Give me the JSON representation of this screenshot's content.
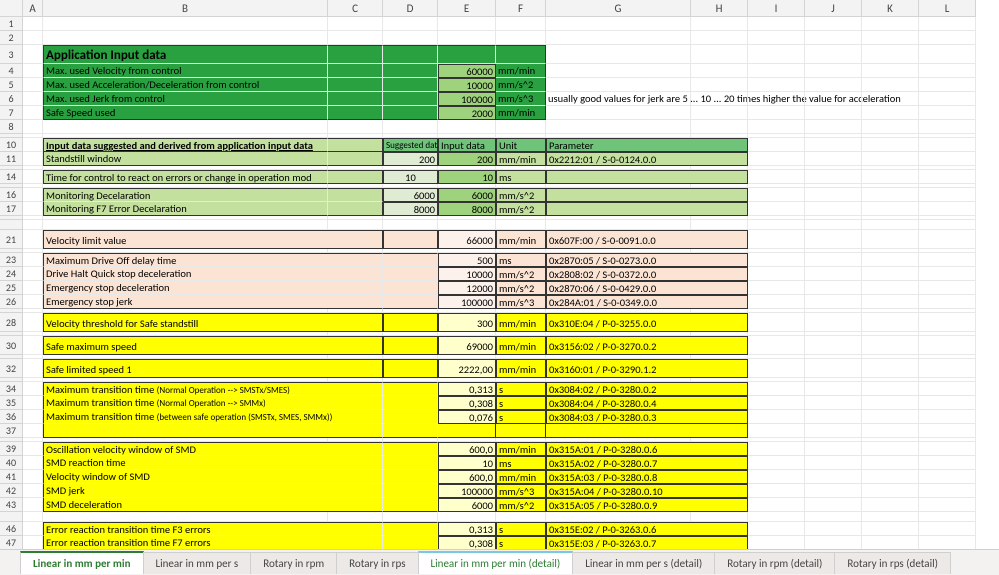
{
  "columns": [
    "A",
    "B",
    "C",
    "D",
    "E",
    "F",
    "G",
    "H",
    "I",
    "J",
    "K",
    "L"
  ],
  "rowNums": [
    "1",
    "2",
    "3",
    "4",
    "5",
    "6",
    "7",
    "8",
    "",
    "10",
    "11",
    "",
    "14",
    "",
    "16",
    "17",
    "",
    "",
    "21",
    "",
    "23",
    "24",
    "25",
    "26",
    "",
    "28",
    "",
    "30",
    "",
    "32",
    "",
    "34",
    "35",
    "36",
    "37",
    "",
    "39",
    "40",
    "41",
    "42",
    "43",
    "",
    "46",
    "47"
  ],
  "section1": {
    "title": "Application Input data",
    "r1": "Max. used Velocity from control",
    "r1v": "60000",
    "r1u": "mm/min",
    "r2": "Max. used Acceleration/Deceleration from control",
    "r2v": "10000",
    "r2u": "mm/s^2",
    "r3": "Max. used Jerk from control",
    "r3v": "100000",
    "r3u": "mm/s^3",
    "r4": "Safe Speed used",
    "r4v": "2000",
    "r4u": "mm/min",
    "note": "usually good values for jerk are 5 ... 10 ... 20 times higher the value for acceleration"
  },
  "section2": {
    "title": "Input data suggested and derived from application input data",
    "h_sug": "Suggested data",
    "h_in": "Input data",
    "h_un": "Unit",
    "h_par": "Parameter",
    "r1": "Standstill window",
    "r1s": "200",
    "r1v": "200",
    "r1u": "mm/min",
    "r1p": "0x2212:01 / S-0-0124.0.0",
    "r2": "Time for control to react on errors or change in operation mod",
    "r2s": "10",
    "r2v": "10",
    "r2u": "ms",
    "r3": "Monitoring Decelaration",
    "r3s": "6000",
    "r3v": "6000",
    "r3u": "mm/s^2",
    "r4": "Monitoring F7 Error Decelaration",
    "r4s": "8000",
    "r4v": "8000",
    "r4u": "mm/s^2"
  },
  "section3": {
    "r1": "Velocity limit value",
    "r1v": "66000",
    "r1u": "mm/min",
    "r1p": "0x607F:00 / S-0-0091.0.0",
    "r2": "Maximum Drive Off delay time",
    "r2v": "500",
    "r2u": "ms",
    "r2p": "0x2870:05 / S-0-0273.0.0",
    "r3": "Drive Halt Quick stop deceleration",
    "r3v": "10000",
    "r3u": "mm/s^2",
    "r3p": "0x2808:02 / S-0-0372.0.0",
    "r4": "Emergency stop deceleration",
    "r4v": "12000",
    "r4u": "mm/s^2",
    "r4p": "0x2870:06 / S-0-0429.0.0",
    "r5": "Emergency stop jerk",
    "r5v": "100000",
    "r5u": "mm/s^3",
    "r5p": "0x284A:01 / S-0-0349.0.0"
  },
  "section4": {
    "r1": "Velocity threshold for Safe standstill",
    "r1v": "300",
    "r1u": "mm/min",
    "r1p": "0x310E:04 / P-0-3255.0.0",
    "r2": "Safe maximum speed",
    "r2v": "69000",
    "r2u": "mm/min",
    "r2p": "0x3156:02 / P-0-3270.0.2",
    "r3": "Safe limited speed 1",
    "r3v": "2222,00",
    "r3u": "mm/min",
    "r3p": "0x3160:01 / P-0-3290.1.2",
    "r4a": "Maximum transition time ",
    "r4b": "(Normal Operation --> SMSTx/SMES)",
    "r4v": "0,313",
    "r4u": "s",
    "r4p": "0x3084:02 / P-0-3280.0.2",
    "r5a": "Maximum transition time ",
    "r5b": "(Normal Operation --> SMMx)",
    "r5v": "0,308",
    "r5u": "s",
    "r5p": "0x3084:04 / P-0-3280.0.4",
    "r6a": "Maximum transition time ",
    "r6b": "(between safe operation (SMSTx, SMES, SMMx))",
    "r6v": "0,076",
    "r6u": "s",
    "r6p": "0x3084:03 / P-0-3280.0.3",
    "r7": "Oscillation velocity window of SMD",
    "r7v": "600,0",
    "r7u": "mm/min",
    "r7p": "0x315A:01 / P-0-3280.0.6",
    "r8": "SMD reaction time",
    "r8v": "10",
    "r8u": "ms",
    "r8p": "0x315A:02 / P-0-3280.0.7",
    "r9": "Velocity window of SMD",
    "r9v": "600,0",
    "r9u": "mm/min",
    "r9p": "0x315A:03 / P-0-3280.0.8",
    "r10": "SMD jerk",
    "r10v": "100000",
    "r10u": "mm/s^3",
    "r10p": "0x315A:04 / P-0-3280.0.10",
    "r11": "SMD deceleration",
    "r11v": "6000",
    "r11u": "mm/s^2",
    "r11p": "0x315A:05 / P-0-3280.0.9",
    "r12": "Error reaction transition time F3 errors",
    "r12v": "0,313",
    "r12u": "s",
    "r12p": "0x315E:02 / P-0-3263.0.6",
    "r13": "Error reaction transition time F7 errors",
    "r13v": "0,308",
    "r13u": "s",
    "r13p": "0x315E:03 / P-0-3263.0.7"
  },
  "tabs": [
    "Linear in mm per min",
    "Linear in mm per s",
    "Rotary in rpm",
    "Rotary in rps",
    "Linear in mm per min (detail)",
    "Linear in mm per s (detail)",
    "Rotary in rpm (detail)",
    "Rotary in rps (detail)"
  ]
}
